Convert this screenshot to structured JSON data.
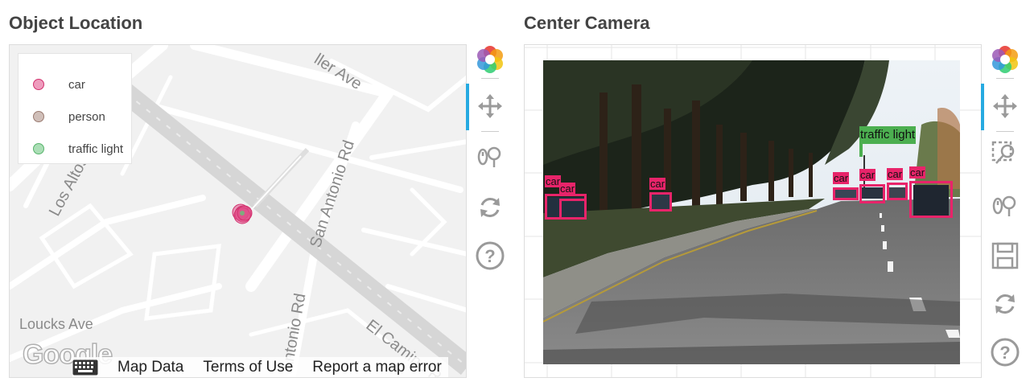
{
  "map_panel": {
    "title": "Object Location",
    "legend": [
      {
        "label": "car",
        "color": "#e04a86"
      },
      {
        "label": "person",
        "color": "#a98a80"
      },
      {
        "label": "traffic light",
        "color": "#66c27a"
      }
    ],
    "street_labels": [
      "ller Ave",
      "Los Altos",
      "San Antonio Rd",
      "Antonio Rd",
      "El Camino R",
      "Loucks Ave"
    ],
    "google_logo": "Google",
    "footer": {
      "keyboard_icon": "keyboard-icon",
      "map_data": "Map Data",
      "terms": "Terms of Use",
      "report": "Report a map error"
    }
  },
  "toolbar_left": {
    "tools": [
      "bokeh-logo-icon",
      "pan-icon",
      "wheel-zoom-icon",
      "reset-icon",
      "help-icon"
    ]
  },
  "camera_panel": {
    "title": "Center Camera",
    "detections": [
      {
        "label": "car",
        "color": "#e8246a"
      },
      {
        "label": "car",
        "color": "#e8246a"
      },
      {
        "label": "car",
        "color": "#e8246a"
      },
      {
        "label": "traffic light",
        "color": "#4caf50"
      },
      {
        "label": "car",
        "color": "#e8246a"
      },
      {
        "label": "car",
        "color": "#e8246a"
      },
      {
        "label": "car",
        "color": "#e8246a"
      },
      {
        "label": "car",
        "color": "#e8246a"
      }
    ]
  },
  "toolbar_right": {
    "tools": [
      "bokeh-logo-icon",
      "pan-icon",
      "box-zoom-icon",
      "wheel-zoom-icon",
      "save-icon",
      "reset-icon",
      "help-icon"
    ]
  }
}
